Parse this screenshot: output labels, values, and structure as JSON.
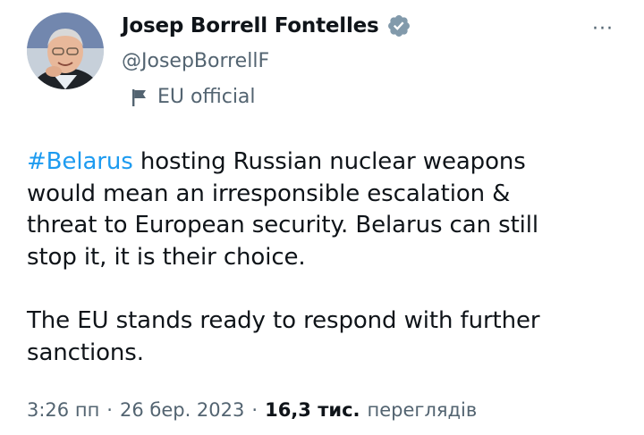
{
  "author": {
    "display_name": "Josep Borrell Fontelles",
    "handle": "@JosepBorrellF",
    "verified_icon": "verified-badge-icon",
    "affiliation_icon": "flag-icon",
    "affiliation_label": "EU official"
  },
  "menu": {
    "more_label": "···"
  },
  "tweet": {
    "hashtag": "#Belarus",
    "paragraph1_rest": " hosting Russian nuclear weapons\nwould mean an irresponsible escalation &\nthreat to European security.  Belarus can still\nstop it, it is their choice.",
    "paragraph2": "The EU stands ready to respond with further\nsanctions."
  },
  "meta": {
    "time": "3:26 пп",
    "separator": "·",
    "date": "26 бер. 2023",
    "views_count": "16,3 тис.",
    "views_label": "переглядів"
  },
  "colors": {
    "hashtag": "#1d9bf0",
    "verified_badge": "#829aab",
    "secondary_text": "#536471",
    "primary_text": "#0f1419"
  }
}
